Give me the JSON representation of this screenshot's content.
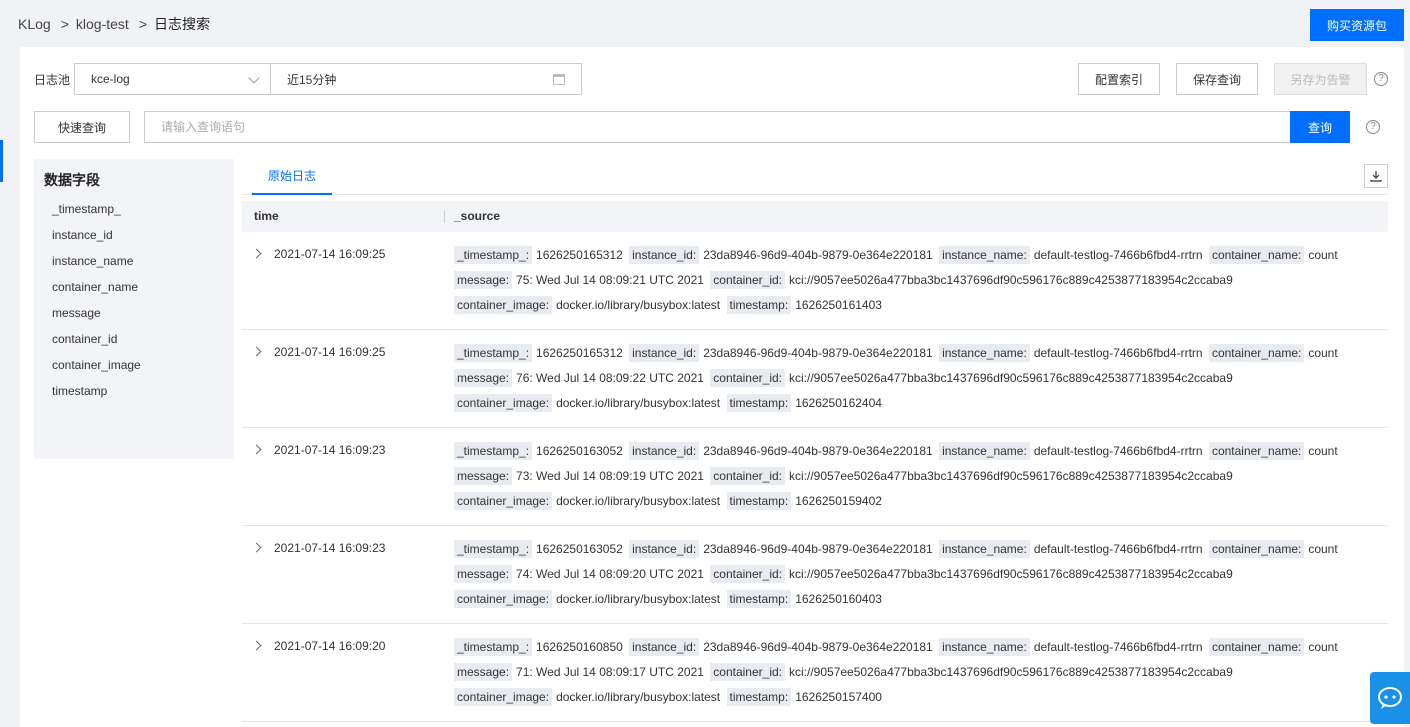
{
  "breadcrumb": [
    "KLog",
    "klog-test",
    "日志搜索"
  ],
  "header": {
    "buy_label": "购买资源包"
  },
  "toolbar": {
    "pool_label": "日志池",
    "pool_value": "kce-log",
    "time_range": "近15分钟",
    "config_index": "配置索引",
    "save_query": "保存查询",
    "save_as_alarm": "另存为告警",
    "help": "?"
  },
  "query": {
    "quick_query": "快速查询",
    "placeholder": "请输入查询语句",
    "submit": "查询"
  },
  "fields": {
    "title": "数据字段",
    "items": [
      "_timestamp_",
      "instance_id",
      "instance_name",
      "container_name",
      "message",
      "container_id",
      "container_image",
      "timestamp"
    ]
  },
  "tabs": {
    "raw_logs": "原始日志"
  },
  "table": {
    "col_time": "time",
    "col_source": "_source"
  },
  "logs": [
    {
      "time": "2021-07-14 16:09:25",
      "fields": [
        [
          "_timestamp_:",
          "1626250165312"
        ],
        [
          "instance_id:",
          "23da8946-96d9-404b-9879-0e364e220181"
        ],
        [
          "instance_name:",
          "default-testlog-7466b6fbd4-rrtrn"
        ],
        [
          "container_name:",
          "count"
        ],
        [
          "message:",
          "75: Wed Jul 14 08:09:21 UTC 2021"
        ],
        [
          "container_id:",
          "kci://9057ee5026a477bba3bc1437696df90c596176c889c4253877183954c2ccaba9"
        ],
        [
          "container_image:",
          "docker.io/library/busybox:latest"
        ],
        [
          "timestamp:",
          "1626250161403"
        ]
      ]
    },
    {
      "time": "2021-07-14 16:09:25",
      "fields": [
        [
          "_timestamp_:",
          "1626250165312"
        ],
        [
          "instance_id:",
          "23da8946-96d9-404b-9879-0e364e220181"
        ],
        [
          "instance_name:",
          "default-testlog-7466b6fbd4-rrtrn"
        ],
        [
          "container_name:",
          "count"
        ],
        [
          "message:",
          "76: Wed Jul 14 08:09:22 UTC 2021"
        ],
        [
          "container_id:",
          "kci://9057ee5026a477bba3bc1437696df90c596176c889c4253877183954c2ccaba9"
        ],
        [
          "container_image:",
          "docker.io/library/busybox:latest"
        ],
        [
          "timestamp:",
          "1626250162404"
        ]
      ]
    },
    {
      "time": "2021-07-14 16:09:23",
      "fields": [
        [
          "_timestamp_:",
          "1626250163052"
        ],
        [
          "instance_id:",
          "23da8946-96d9-404b-9879-0e364e220181"
        ],
        [
          "instance_name:",
          "default-testlog-7466b6fbd4-rrtrn"
        ],
        [
          "container_name:",
          "count"
        ],
        [
          "message:",
          "73: Wed Jul 14 08:09:19 UTC 2021"
        ],
        [
          "container_id:",
          "kci://9057ee5026a477bba3bc1437696df90c596176c889c4253877183954c2ccaba9"
        ],
        [
          "container_image:",
          "docker.io/library/busybox:latest"
        ],
        [
          "timestamp:",
          "1626250159402"
        ]
      ]
    },
    {
      "time": "2021-07-14 16:09:23",
      "fields": [
        [
          "_timestamp_:",
          "1626250163052"
        ],
        [
          "instance_id:",
          "23da8946-96d9-404b-9879-0e364e220181"
        ],
        [
          "instance_name:",
          "default-testlog-7466b6fbd4-rrtrn"
        ],
        [
          "container_name:",
          "count"
        ],
        [
          "message:",
          "74: Wed Jul 14 08:09:20 UTC 2021"
        ],
        [
          "container_id:",
          "kci://9057ee5026a477bba3bc1437696df90c596176c889c4253877183954c2ccaba9"
        ],
        [
          "container_image:",
          "docker.io/library/busybox:latest"
        ],
        [
          "timestamp:",
          "1626250160403"
        ]
      ]
    },
    {
      "time": "2021-07-14 16:09:20",
      "fields": [
        [
          "_timestamp_:",
          "1626250160850"
        ],
        [
          "instance_id:",
          "23da8946-96d9-404b-9879-0e364e220181"
        ],
        [
          "instance_name:",
          "default-testlog-7466b6fbd4-rrtrn"
        ],
        [
          "container_name:",
          "count"
        ],
        [
          "message:",
          "71: Wed Jul 14 08:09:17 UTC 2021"
        ],
        [
          "container_id:",
          "kci://9057ee5026a477bba3bc1437696df90c596176c889c4253877183954c2ccaba9"
        ],
        [
          "container_image:",
          "docker.io/library/busybox:latest"
        ],
        [
          "timestamp:",
          "1626250157400"
        ]
      ]
    }
  ],
  "icons": {
    "chevron": "chevron-down-icon",
    "calendar": "calendar-icon",
    "download": "download-icon",
    "expand": "chevron-right-icon",
    "chat": "chat-icon"
  },
  "colors": {
    "accent": "#006eff",
    "chat": "#1a90e8"
  }
}
